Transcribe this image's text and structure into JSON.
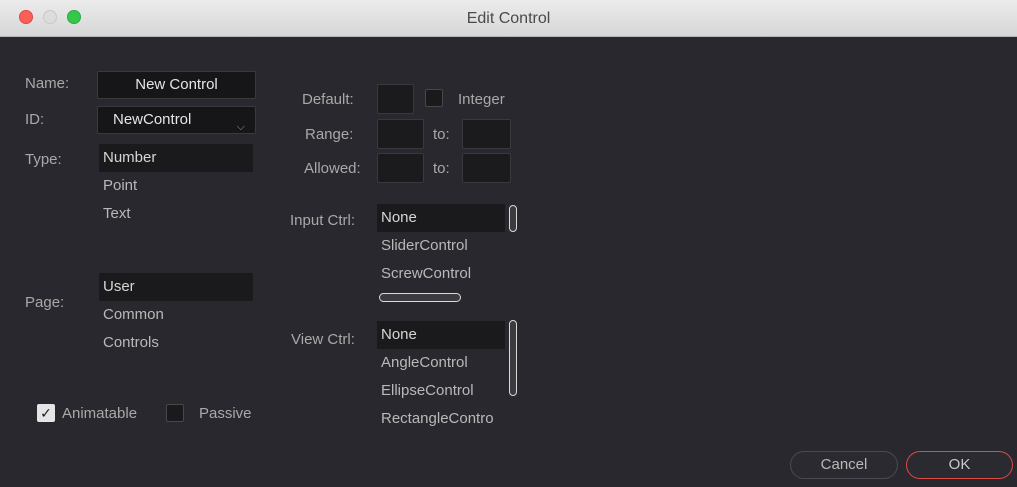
{
  "window": {
    "title": "Edit Control"
  },
  "name": {
    "label": "Name:",
    "value": "New Control"
  },
  "id": {
    "label": "ID:",
    "value": "NewControl"
  },
  "type": {
    "label": "Type:",
    "options": [
      "Number",
      "Point",
      "Text"
    ],
    "selected": "Number"
  },
  "page": {
    "label": "Page:",
    "options": [
      "User",
      "Common",
      "Controls"
    ],
    "selected": "User"
  },
  "checks": {
    "animatable": {
      "label": "Animatable",
      "checked": true
    },
    "passive": {
      "label": "Passive",
      "checked": false
    }
  },
  "default": {
    "label": "Default:",
    "value": ""
  },
  "integer": {
    "label": "Integer",
    "checked": false
  },
  "range": {
    "label": "Range:",
    "to_label": "to:",
    "from": "",
    "to": ""
  },
  "allowed": {
    "label": "Allowed:",
    "to_label": "to:",
    "from": "",
    "to": ""
  },
  "input_ctrl": {
    "label": "Input Ctrl:",
    "options": [
      "None",
      "SliderControl",
      "ScrewControl"
    ],
    "selected": "None"
  },
  "view_ctrl": {
    "label": "View Ctrl:",
    "options": [
      "None",
      "AngleControl",
      "EllipseControl",
      "RectangleContro"
    ],
    "selected": "None"
  },
  "buttons": {
    "cancel": "Cancel",
    "ok": "OK"
  },
  "icons": {
    "check": "✓",
    "chevron": "⌵"
  },
  "colors": {
    "accent": "#e04a44",
    "background": "#28282e"
  }
}
